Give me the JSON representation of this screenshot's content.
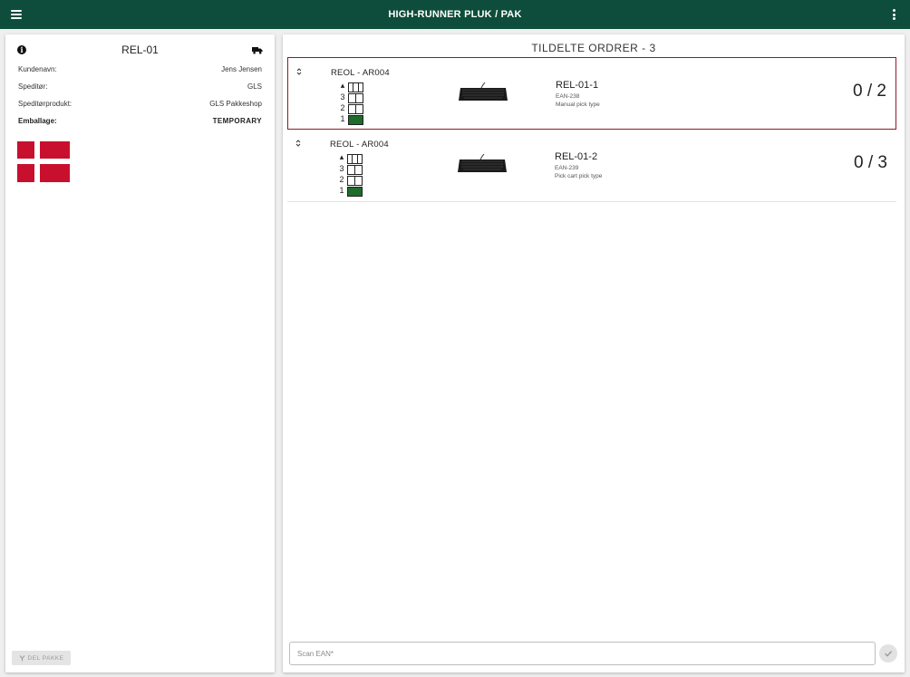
{
  "appbar": {
    "title": "HIGH-RUNNER PLUK / PAK",
    "menu_icon": "hamburger-icon",
    "more_icon": "kebab-icon",
    "color": "#0e4d3b"
  },
  "package": {
    "reference": "REL-01",
    "info_icon": "info-icon",
    "carrier_icon": "truck-icon",
    "rows": [
      {
        "label": "Kundenavn:",
        "value": "Jens Jensen"
      },
      {
        "label": "Speditør:",
        "value": "GLS"
      },
      {
        "label": "Speditørprodukt:",
        "value": "GLS Pakkeshop"
      },
      {
        "label": "Emballage:",
        "value": "TEMPORARY"
      }
    ],
    "flag": "denmark-flag",
    "flag_color": "#c8102e",
    "split_button": "DEL PAKKE",
    "split_icon": "split-icon"
  },
  "orders": {
    "heading": "TILDELTE ORDRER - 3",
    "selected_border_color": "#8e1b26",
    "filled_level_color": "#1e6b2a",
    "items": [
      {
        "location": "REOL - AR004",
        "levels": [
          "3",
          "2",
          "1"
        ],
        "filled_level": "1",
        "product_name": "REL-01-1",
        "ean": "EAN-238",
        "pick_type": "Manual pick type",
        "quantity": "0 / 2",
        "selected": true
      },
      {
        "location": "REOL - AR004",
        "levels": [
          "3",
          "2",
          "1"
        ],
        "filled_level": "1",
        "product_name": "REL-01-2",
        "ean": "EAN-239",
        "pick_type": "Pick cart pick type",
        "quantity": "0 / 3",
        "selected": false
      }
    ]
  },
  "scan": {
    "placeholder": "Scan EAN*",
    "value": "",
    "confirm_icon": "check-icon"
  }
}
